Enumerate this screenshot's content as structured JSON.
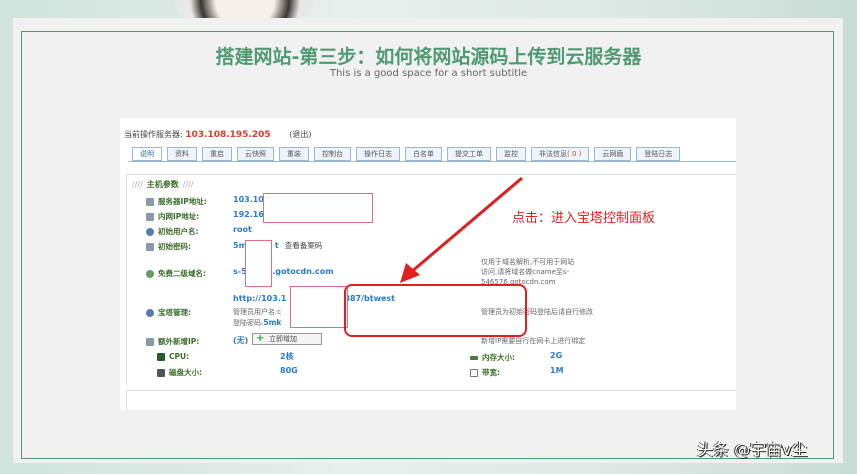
{
  "slide": {
    "title": "搭建网站-第三步：如何将网站源码上传到云服务器",
    "subtitle": "This is a good space for a short subtitle"
  },
  "panel": {
    "server_label": "当前操作服务器:",
    "server_ip": "103.108.195.205",
    "logout": "(退出)",
    "tabs": [
      "说明",
      "资料",
      "重启",
      "云快照",
      "重装",
      "控制台",
      "操作日志",
      "白名单",
      "提交工单",
      "监控",
      "非法信息",
      "云网盾",
      "登陆日志"
    ],
    "illegal_count": "( 0 )",
    "section_title": "主机参数",
    "rows": {
      "server_ip": {
        "label": "服务器IP地址:",
        "value": "103.10"
      },
      "lan_ip": {
        "label": "内网IP地址:",
        "value": "192.16"
      },
      "user": {
        "label": "初始用户名:",
        "value": "root"
      },
      "password": {
        "label": "初始密码:",
        "value": "5m",
        "value_tail": "t",
        "link": "查看备案码"
      },
      "domain": {
        "label": "免费二级域名:",
        "value": "s-5",
        "value_tail": "6.gotocdn.com",
        "note1": "仅用于域名解析,不可用于网站",
        "note2": "访问.请将域名做cname至s-",
        "note3": "546576.gotocdn.com"
      },
      "bt": {
        "label": "宝塔管理:",
        "url": "http://103.1",
        "url_tail": "887/btwest",
        "admin_user": "管理员用户名:c",
        "admin_pass_label": "登陆密码:",
        "admin_pass": "5mk",
        "note": "管理员为初始密码登陆后请自行修改"
      },
      "extra_ip": {
        "label": "额外新增IP:",
        "value": "(无)",
        "button": "立即增加",
        "note": "新增IP需要自行在网卡上进行绑定"
      },
      "cpu": {
        "label": "CPU:",
        "value": "2核"
      },
      "memory": {
        "label": "内存大小:",
        "value": "2G"
      },
      "disk": {
        "label": "磁盘大小:",
        "value": "80G"
      },
      "bandwidth": {
        "label": "带宽:",
        "value": "1M"
      }
    }
  },
  "annotation": {
    "callout": "点击：进入宝塔控制面板"
  },
  "watermark": "头条 @宇宙v尘"
}
